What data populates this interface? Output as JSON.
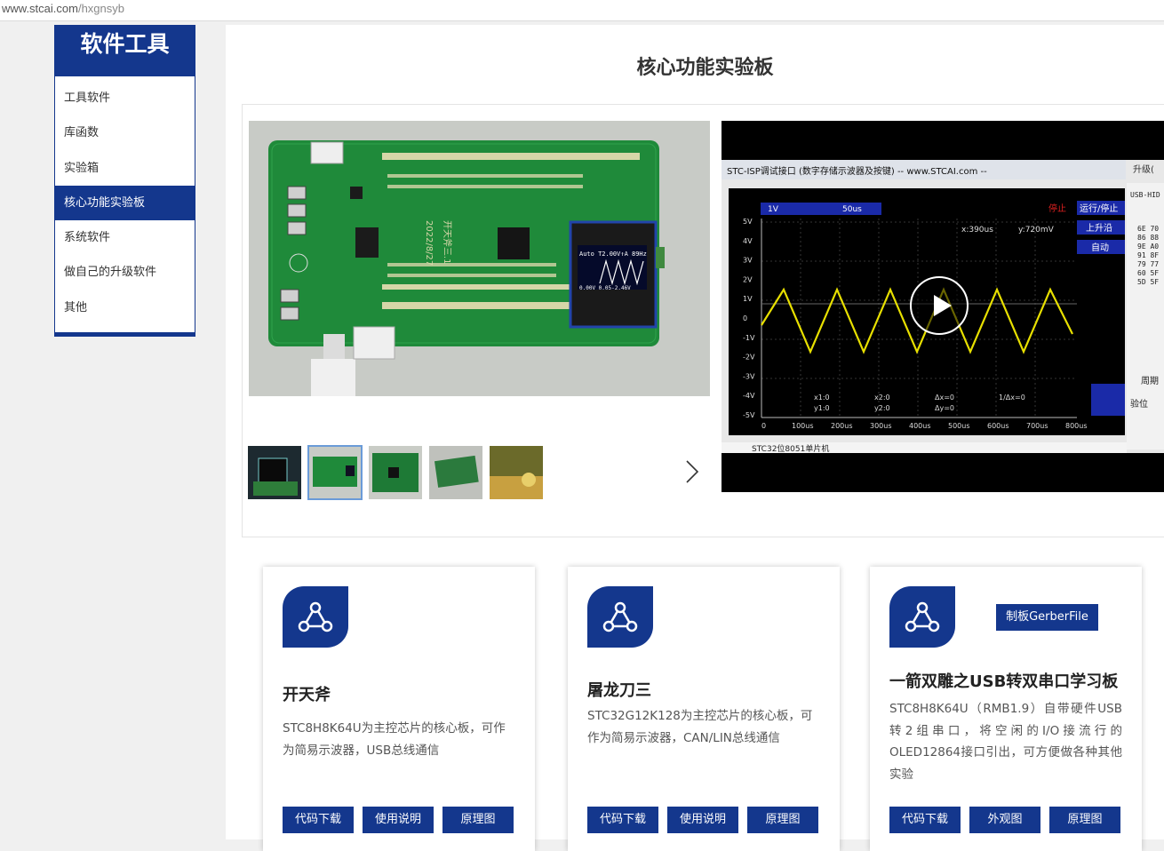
{
  "browser": {
    "url_host": "www.stcai.com",
    "url_path": "/hxgnsyb"
  },
  "sidebar": {
    "title": "软件工具",
    "items": [
      {
        "label": "工具软件"
      },
      {
        "label": "库函数"
      },
      {
        "label": "实验箱"
      },
      {
        "label": "核心功能实验板",
        "active": true
      },
      {
        "label": "系统软件"
      },
      {
        "label": "做自己的升级软件"
      },
      {
        "label": "其他"
      }
    ]
  },
  "main": {
    "page_title": "核心功能实验板"
  },
  "gallery": {
    "board_labels": {
      "date": "2022/8/27",
      "name": "开天斧三.1",
      "oled_line1": "Auto  T2.00V↑A 89Hz",
      "oled_line2": "0.00V 0.05-2.46V"
    },
    "thumbnails": [
      {
        "name": "thumb-1"
      },
      {
        "name": "thumb-2",
        "selected": true
      },
      {
        "name": "thumb-3"
      },
      {
        "name": "thumb-4"
      },
      {
        "name": "thumb-5"
      }
    ]
  },
  "video": {
    "window_title": "STC-ISP调试接口 (数字存储示波器及按键) -- www.STCAI.com --",
    "side_label": "升级(",
    "usb_label": "USB-HID",
    "volt_btn": "1V",
    "time_btn": "50us",
    "stop_label": "停止",
    "run_btn": "运行/停止",
    "rise_btn": "上升沿",
    "auto_btn": "自动",
    "x_readout": "x:390us",
    "y_readout": "y:720mV",
    "y_ticks": [
      "5V",
      "4V",
      "3V",
      "2V",
      "1V",
      "0",
      "-1V",
      "-2V",
      "-3V",
      "-4V",
      "-5V"
    ],
    "x_ticks": [
      "0",
      "100us",
      "200us",
      "300us",
      "400us",
      "500us",
      "600us",
      "700us",
      "800us"
    ],
    "cursor_labels": [
      "x1:0",
      "y1:0",
      "x2:0",
      "y2:0",
      "Δx=0",
      "Δy=0",
      "1/Δx=0"
    ],
    "hex_cols": [
      "6E 70",
      "86 88",
      "9E A0",
      "91 8F",
      "79 77",
      "60 5F",
      "5D 5F"
    ],
    "right_labels": [
      "周期",
      "验位"
    ],
    "bottom_text": "STC32位8051单片机"
  },
  "cards": [
    {
      "title": "开天斧",
      "desc": "STC8H8K64U为主控芯片的核心板，可作为简易示波器，USB总线通信",
      "buttons": [
        "代码下载",
        "使用说明",
        "原理图"
      ]
    },
    {
      "title": "屠龙刀三",
      "desc": "STC32G12K128为主控芯片的核心板，可作为简易示波器，CAN/LIN总线通信",
      "buttons": [
        "代码下载",
        "使用说明",
        "原理图"
      ]
    },
    {
      "title": "一箭双雕之USB转双串口学习板",
      "extra_button": "制板GerberFile",
      "desc": "STC8H8K64U（RMB1.9）自带硬件USB转2组串口，将空闲的I/O接流行的OLED12864接口引出，可方便做各种其他实验",
      "buttons": [
        "代码下载",
        "外观图",
        "原理图"
      ]
    }
  ],
  "colors": {
    "brand": "#14378d",
    "board": "#1f8a3a",
    "trace": "#e8e000"
  }
}
